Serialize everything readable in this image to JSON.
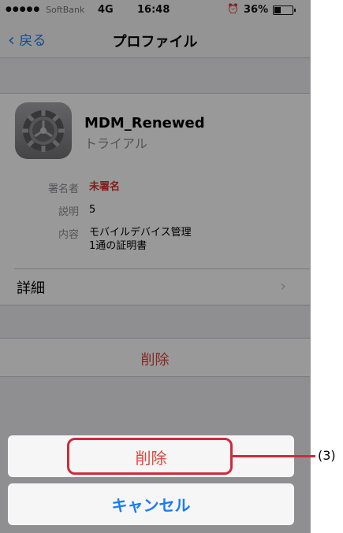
{
  "status_bar": {
    "signal": "●●●●●",
    "carrier": "SoftBank",
    "network": "4G",
    "time": "16:48",
    "alarm_icon": "alarm-clock-icon",
    "battery": "36%",
    "battery_level": 0.36
  },
  "nav": {
    "back_label": "戻る",
    "title": "プロファイル"
  },
  "profile": {
    "name": "MDM_Renewed",
    "subtitle": "トライアル",
    "icon": "settings-gear-icon",
    "signer_label": "署名者",
    "signer_value": "未署名",
    "description_label": "説明",
    "description_value": "5",
    "contents_label": "内容",
    "contents_line1": "モバイルデバイス管理",
    "contents_line2": "1通の証明書",
    "detail_label": "詳細"
  },
  "delete_row": {
    "label": "削除"
  },
  "action_sheet": {
    "delete_label": "削除",
    "cancel_label": "キャンセル"
  },
  "annotation": {
    "label": "(3)"
  },
  "colors": {
    "accent_blue": "#1a7cf5",
    "destructive_red": "#e0443a",
    "highlight_red": "#d1293a"
  }
}
